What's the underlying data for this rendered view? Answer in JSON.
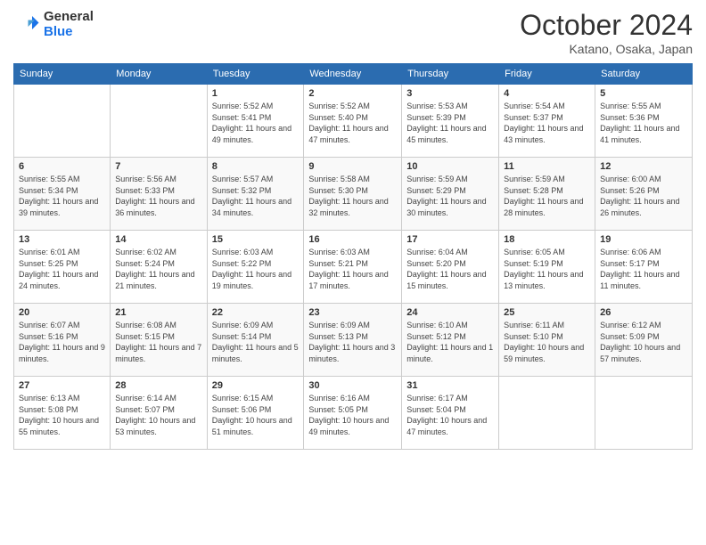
{
  "header": {
    "logo_line1": "General",
    "logo_line2": "Blue",
    "month": "October 2024",
    "location": "Katano, Osaka, Japan"
  },
  "weekdays": [
    "Sunday",
    "Monday",
    "Tuesday",
    "Wednesday",
    "Thursday",
    "Friday",
    "Saturday"
  ],
  "weeks": [
    [
      {
        "day": "",
        "info": ""
      },
      {
        "day": "",
        "info": ""
      },
      {
        "day": "1",
        "info": "Sunrise: 5:52 AM\nSunset: 5:41 PM\nDaylight: 11 hours and 49 minutes."
      },
      {
        "day": "2",
        "info": "Sunrise: 5:52 AM\nSunset: 5:40 PM\nDaylight: 11 hours and 47 minutes."
      },
      {
        "day": "3",
        "info": "Sunrise: 5:53 AM\nSunset: 5:39 PM\nDaylight: 11 hours and 45 minutes."
      },
      {
        "day": "4",
        "info": "Sunrise: 5:54 AM\nSunset: 5:37 PM\nDaylight: 11 hours and 43 minutes."
      },
      {
        "day": "5",
        "info": "Sunrise: 5:55 AM\nSunset: 5:36 PM\nDaylight: 11 hours and 41 minutes."
      }
    ],
    [
      {
        "day": "6",
        "info": "Sunrise: 5:55 AM\nSunset: 5:34 PM\nDaylight: 11 hours and 39 minutes."
      },
      {
        "day": "7",
        "info": "Sunrise: 5:56 AM\nSunset: 5:33 PM\nDaylight: 11 hours and 36 minutes."
      },
      {
        "day": "8",
        "info": "Sunrise: 5:57 AM\nSunset: 5:32 PM\nDaylight: 11 hours and 34 minutes."
      },
      {
        "day": "9",
        "info": "Sunrise: 5:58 AM\nSunset: 5:30 PM\nDaylight: 11 hours and 32 minutes."
      },
      {
        "day": "10",
        "info": "Sunrise: 5:59 AM\nSunset: 5:29 PM\nDaylight: 11 hours and 30 minutes."
      },
      {
        "day": "11",
        "info": "Sunrise: 5:59 AM\nSunset: 5:28 PM\nDaylight: 11 hours and 28 minutes."
      },
      {
        "day": "12",
        "info": "Sunrise: 6:00 AM\nSunset: 5:26 PM\nDaylight: 11 hours and 26 minutes."
      }
    ],
    [
      {
        "day": "13",
        "info": "Sunrise: 6:01 AM\nSunset: 5:25 PM\nDaylight: 11 hours and 24 minutes."
      },
      {
        "day": "14",
        "info": "Sunrise: 6:02 AM\nSunset: 5:24 PM\nDaylight: 11 hours and 21 minutes."
      },
      {
        "day": "15",
        "info": "Sunrise: 6:03 AM\nSunset: 5:22 PM\nDaylight: 11 hours and 19 minutes."
      },
      {
        "day": "16",
        "info": "Sunrise: 6:03 AM\nSunset: 5:21 PM\nDaylight: 11 hours and 17 minutes."
      },
      {
        "day": "17",
        "info": "Sunrise: 6:04 AM\nSunset: 5:20 PM\nDaylight: 11 hours and 15 minutes."
      },
      {
        "day": "18",
        "info": "Sunrise: 6:05 AM\nSunset: 5:19 PM\nDaylight: 11 hours and 13 minutes."
      },
      {
        "day": "19",
        "info": "Sunrise: 6:06 AM\nSunset: 5:17 PM\nDaylight: 11 hours and 11 minutes."
      }
    ],
    [
      {
        "day": "20",
        "info": "Sunrise: 6:07 AM\nSunset: 5:16 PM\nDaylight: 11 hours and 9 minutes."
      },
      {
        "day": "21",
        "info": "Sunrise: 6:08 AM\nSunset: 5:15 PM\nDaylight: 11 hours and 7 minutes."
      },
      {
        "day": "22",
        "info": "Sunrise: 6:09 AM\nSunset: 5:14 PM\nDaylight: 11 hours and 5 minutes."
      },
      {
        "day": "23",
        "info": "Sunrise: 6:09 AM\nSunset: 5:13 PM\nDaylight: 11 hours and 3 minutes."
      },
      {
        "day": "24",
        "info": "Sunrise: 6:10 AM\nSunset: 5:12 PM\nDaylight: 11 hours and 1 minute."
      },
      {
        "day": "25",
        "info": "Sunrise: 6:11 AM\nSunset: 5:10 PM\nDaylight: 10 hours and 59 minutes."
      },
      {
        "day": "26",
        "info": "Sunrise: 6:12 AM\nSunset: 5:09 PM\nDaylight: 10 hours and 57 minutes."
      }
    ],
    [
      {
        "day": "27",
        "info": "Sunrise: 6:13 AM\nSunset: 5:08 PM\nDaylight: 10 hours and 55 minutes."
      },
      {
        "day": "28",
        "info": "Sunrise: 6:14 AM\nSunset: 5:07 PM\nDaylight: 10 hours and 53 minutes."
      },
      {
        "day": "29",
        "info": "Sunrise: 6:15 AM\nSunset: 5:06 PM\nDaylight: 10 hours and 51 minutes."
      },
      {
        "day": "30",
        "info": "Sunrise: 6:16 AM\nSunset: 5:05 PM\nDaylight: 10 hours and 49 minutes."
      },
      {
        "day": "31",
        "info": "Sunrise: 6:17 AM\nSunset: 5:04 PM\nDaylight: 10 hours and 47 minutes."
      },
      {
        "day": "",
        "info": ""
      },
      {
        "day": "",
        "info": ""
      }
    ]
  ]
}
